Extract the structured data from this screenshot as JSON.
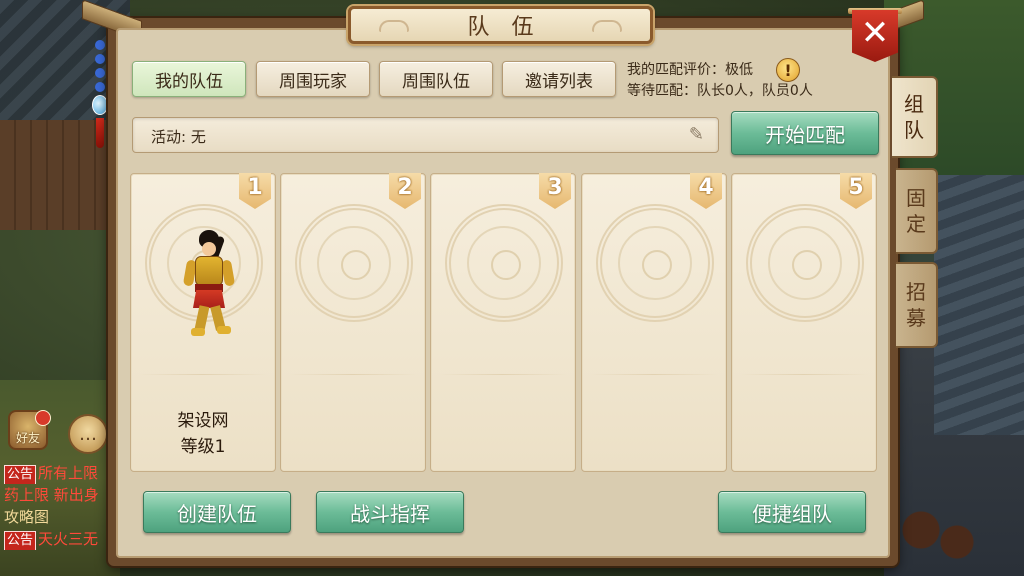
{
  "window": {
    "title": "队伍",
    "close_icon": "close-icon"
  },
  "side_tabs": [
    {
      "label_top": "组",
      "label_bottom": "队",
      "active": true
    },
    {
      "label_top": "固",
      "label_bottom": "定",
      "active": false
    },
    {
      "label_top": "招",
      "label_bottom": "募",
      "active": false
    }
  ],
  "top_tabs": {
    "my_team": "我的队伍",
    "nearby_players": "周围玩家",
    "nearby_teams": "周围队伍",
    "invite_list": "邀请列表",
    "selected": "我的队伍"
  },
  "match": {
    "rating_line": "我的匹配评价：极低",
    "waiting_line": "等待匹配：队长0人，队员0人",
    "warning_icon": "exclamation-icon"
  },
  "activity": {
    "label": "活动: 无",
    "edit_icon": "pencil-icon"
  },
  "buttons": {
    "start_match": "开始匹配",
    "create_team": "创建队伍",
    "battle_command": "战斗指挥",
    "quick_team": "便捷组队"
  },
  "slots": [
    {
      "number": "1",
      "name": "架设网",
      "level": "等级1",
      "occupied": true
    },
    {
      "number": "2",
      "occupied": false
    },
    {
      "number": "3",
      "occupied": false
    },
    {
      "number": "4",
      "occupied": false
    },
    {
      "number": "5",
      "occupied": false
    }
  ],
  "hud": {
    "friends_label": "好友",
    "chat_icon": "chat-bubble-icon",
    "chat": [
      {
        "tag": "公告",
        "text": "所有上限"
      },
      {
        "tag": "",
        "text": "药上限 新出身"
      },
      {
        "tag": "",
        "text": "攻略图"
      },
      {
        "tag": "公告",
        "text": "天火三无"
      }
    ]
  },
  "colors": {
    "accent_green": "#6cbc98",
    "close_red": "#c4261c",
    "panel_bg": "#d9ccb0",
    "frame_brown": "#6b4a2c"
  }
}
